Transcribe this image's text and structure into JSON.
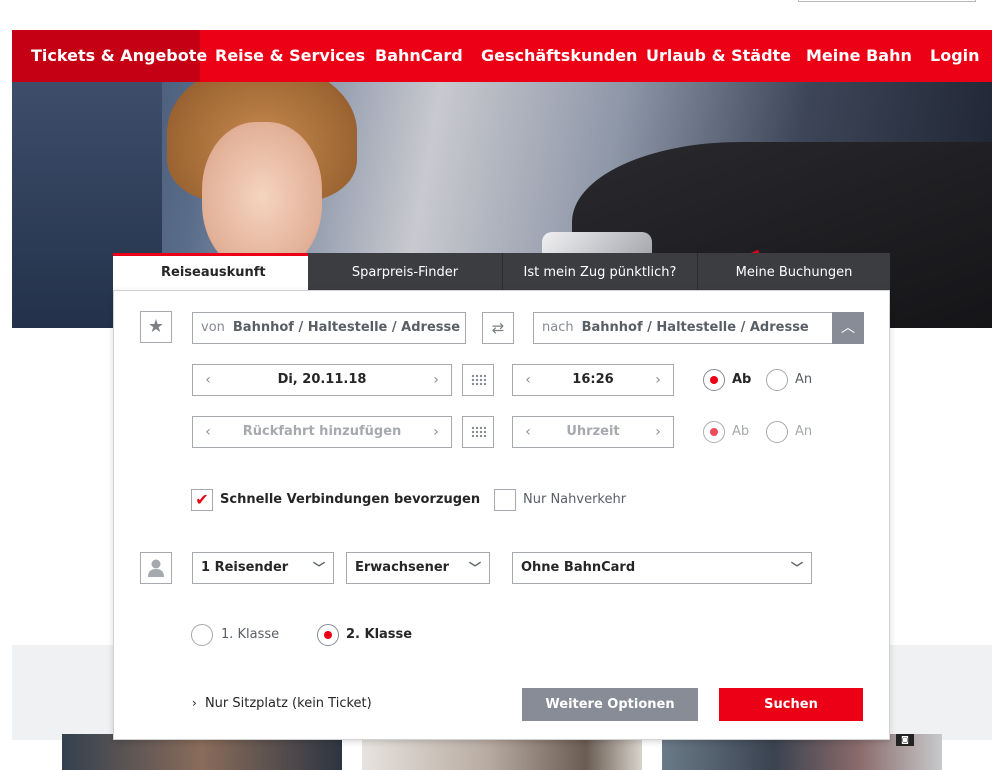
{
  "nav": {
    "items": [
      {
        "label": "Tickets & Angebote",
        "active": true
      },
      {
        "label": "Reise & Services",
        "active": false
      },
      {
        "label": "BahnCard",
        "active": false
      },
      {
        "label": "Geschäftskunden",
        "active": false
      },
      {
        "label": "Urlaub & Städte",
        "active": false
      },
      {
        "label": "Meine Bahn",
        "active": false
      }
    ],
    "login": "Login"
  },
  "tabs": [
    {
      "label": "Reiseauskunft",
      "active": true
    },
    {
      "label": "Sparpreis-Finder",
      "active": false
    },
    {
      "label": "Ist mein Zug pünktlich?",
      "active": false
    },
    {
      "label": "Meine Buchungen",
      "active": false
    }
  ],
  "route": {
    "from_prefix": "von",
    "from_placeholder": "Bahnhof / Haltestelle / Adresse",
    "to_prefix": "nach",
    "to_placeholder": "Bahnhof / Haltestelle / Adresse"
  },
  "outbound": {
    "date": "Di, 20.11.18",
    "time": "16:26",
    "ab_label": "Ab",
    "an_label": "An",
    "selected": "Ab"
  },
  "return": {
    "add_label": "Rückfahrt hinzufügen",
    "time_placeholder": "Uhrzeit",
    "ab_label": "Ab",
    "an_label": "An",
    "selected": "Ab"
  },
  "options": {
    "fast_connections_label": "Schnelle Verbindungen bevorzugen",
    "fast_connections_checked": true,
    "regional_only_label": "Nur Nahverkehr",
    "regional_only_checked": false
  },
  "passengers": {
    "count": "1 Reisender",
    "type": "Erwachsener",
    "bahncard": "Ohne BahnCard"
  },
  "class": {
    "first_label": "1. Klasse",
    "second_label": "2. Klasse",
    "selected": "2. Klasse"
  },
  "seat_only_link": "Nur Sitzplatz (kein Ticket)",
  "buttons": {
    "more_options": "Weitere Optionen",
    "search": "Suchen"
  },
  "colors": {
    "brand_red": "#ec0016",
    "dark_grey": "#3c3d40",
    "button_grey": "#878c96"
  }
}
